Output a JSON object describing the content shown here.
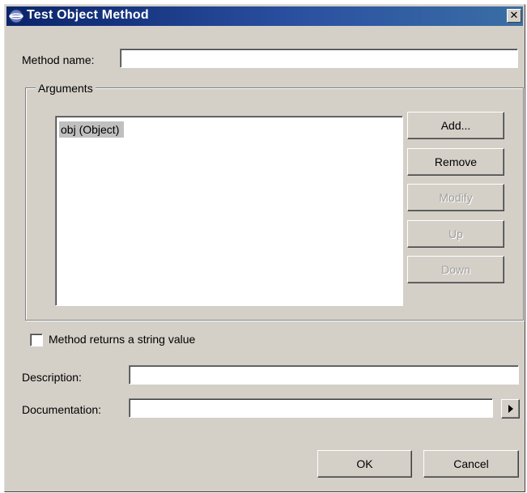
{
  "window": {
    "title": "Test Object Method",
    "close_glyph": "✕"
  },
  "form": {
    "method_name_label": "Method name:",
    "method_name_value": "",
    "arguments_group_label": "Arguments",
    "arguments": [
      "obj (Object)"
    ],
    "buttons": {
      "add": "Add...",
      "remove": "Remove",
      "modify": "Modify",
      "up": "Up",
      "down": "Down"
    },
    "returns_string_label": "Method returns a string value",
    "returns_string_checked": false,
    "description_label": "Description:",
    "description_value": "",
    "documentation_label": "Documentation:",
    "documentation_value": ""
  },
  "footer": {
    "ok": "OK",
    "cancel": "Cancel"
  },
  "icons": {
    "app": "app-icon",
    "close": "close-icon",
    "documentation_arrow": "arrow-right-icon"
  }
}
